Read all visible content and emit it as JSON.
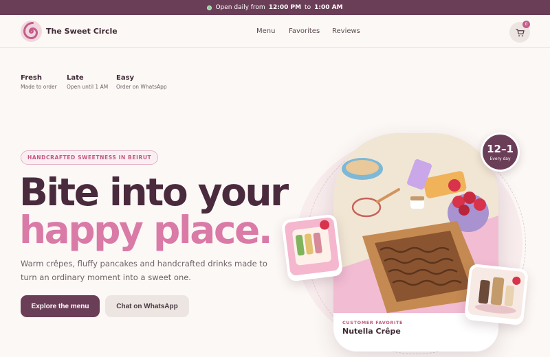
{
  "topbar": {
    "text_prefix": "Open daily from",
    "open_time": "12:00 PM",
    "text_mid": "to",
    "close_time": "1:00 AM"
  },
  "nav": {
    "brand": "The Sweet Circle",
    "links": [
      "Menu",
      "Favorites",
      "Reviews"
    ],
    "cart_count": "0"
  },
  "features": [
    {
      "title": "Fresh",
      "subtitle": "Made to order"
    },
    {
      "title": "Late",
      "subtitle": "Open until 1 AM"
    },
    {
      "title": "Easy",
      "subtitle": "Order on WhatsApp"
    }
  ],
  "hero": {
    "tagline": "HANDCRAFTED SWEETNESS IN BEIRUT",
    "headline_line1": "Bite into your",
    "headline_line2": "happy place.",
    "description": "Warm crêpes, fluffy pancakes and handcrafted drinks made to turn an ordinary moment into a sweet one.",
    "primary_cta": "Explore the menu",
    "secondary_cta": "Chat on WhatsApp"
  },
  "showcase": {
    "hours_badge_main": "12–1",
    "hours_badge_sub": "Every day",
    "label": "CUSTOMER FAVORITE",
    "item_name": "Nutella Crêpe"
  },
  "colors": {
    "brand_plum": "#6b3e58",
    "accent_pink": "#d97aa7",
    "background": "#fcf8f5"
  },
  "icons": [
    "status-dot-icon",
    "spiral-logo-icon",
    "cart-icon"
  ]
}
